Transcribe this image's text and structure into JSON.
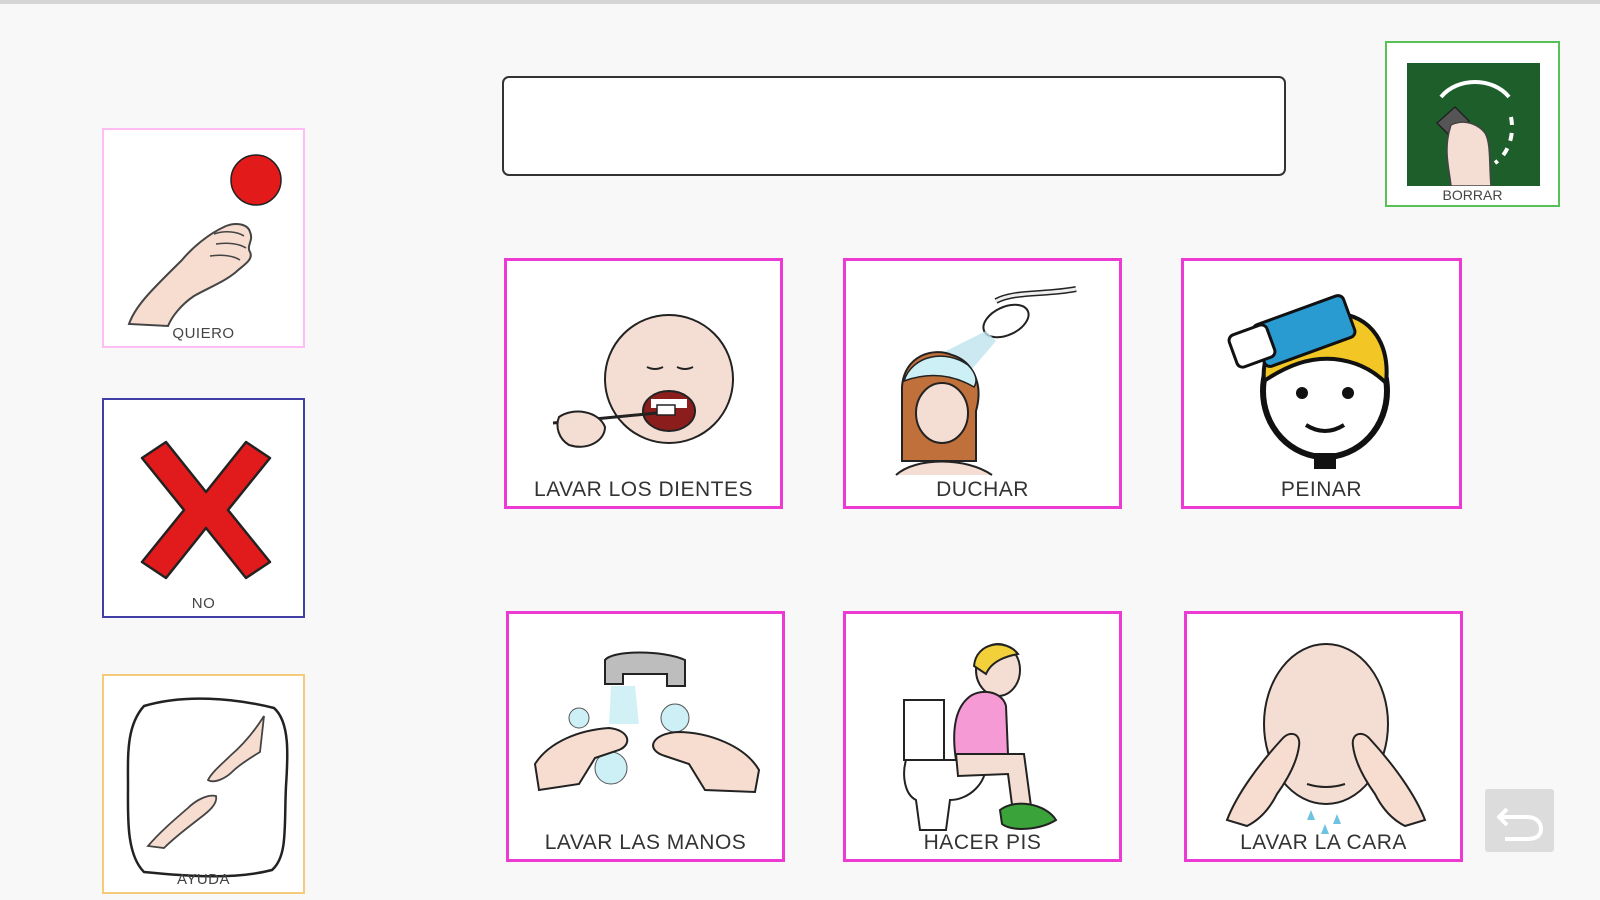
{
  "sentence": {
    "value": ""
  },
  "side_buttons": [
    {
      "label": "QUIERO",
      "border_color": "#ffbdf3",
      "icon": "reach-hand-ball-icon"
    },
    {
      "label": "NO",
      "border_color": "#3f3fa6",
      "icon": "red-x-icon"
    },
    {
      "label": "AYUDA",
      "border_color": "#f7c97a",
      "icon": "helping-hands-icon"
    }
  ],
  "erase_button": {
    "label": "BORRAR",
    "border_color": "#57c157",
    "icon": "erase-board-icon"
  },
  "pictograms": [
    {
      "label": "LAVAR LOS DIENTES",
      "icon": "brush-teeth-icon"
    },
    {
      "label": "DUCHAR",
      "icon": "shower-icon"
    },
    {
      "label": "PEINAR",
      "icon": "comb-hair-icon"
    },
    {
      "label": "LAVAR LAS MANOS",
      "icon": "wash-hands-icon"
    },
    {
      "label": "HACER PIS",
      "icon": "toilet-icon"
    },
    {
      "label": "LAVAR LA CARA",
      "icon": "wash-face-icon"
    }
  ],
  "pictogram_border_color": "#ee3ad5",
  "undo_button": {
    "icon": "undo-arrow-icon"
  }
}
